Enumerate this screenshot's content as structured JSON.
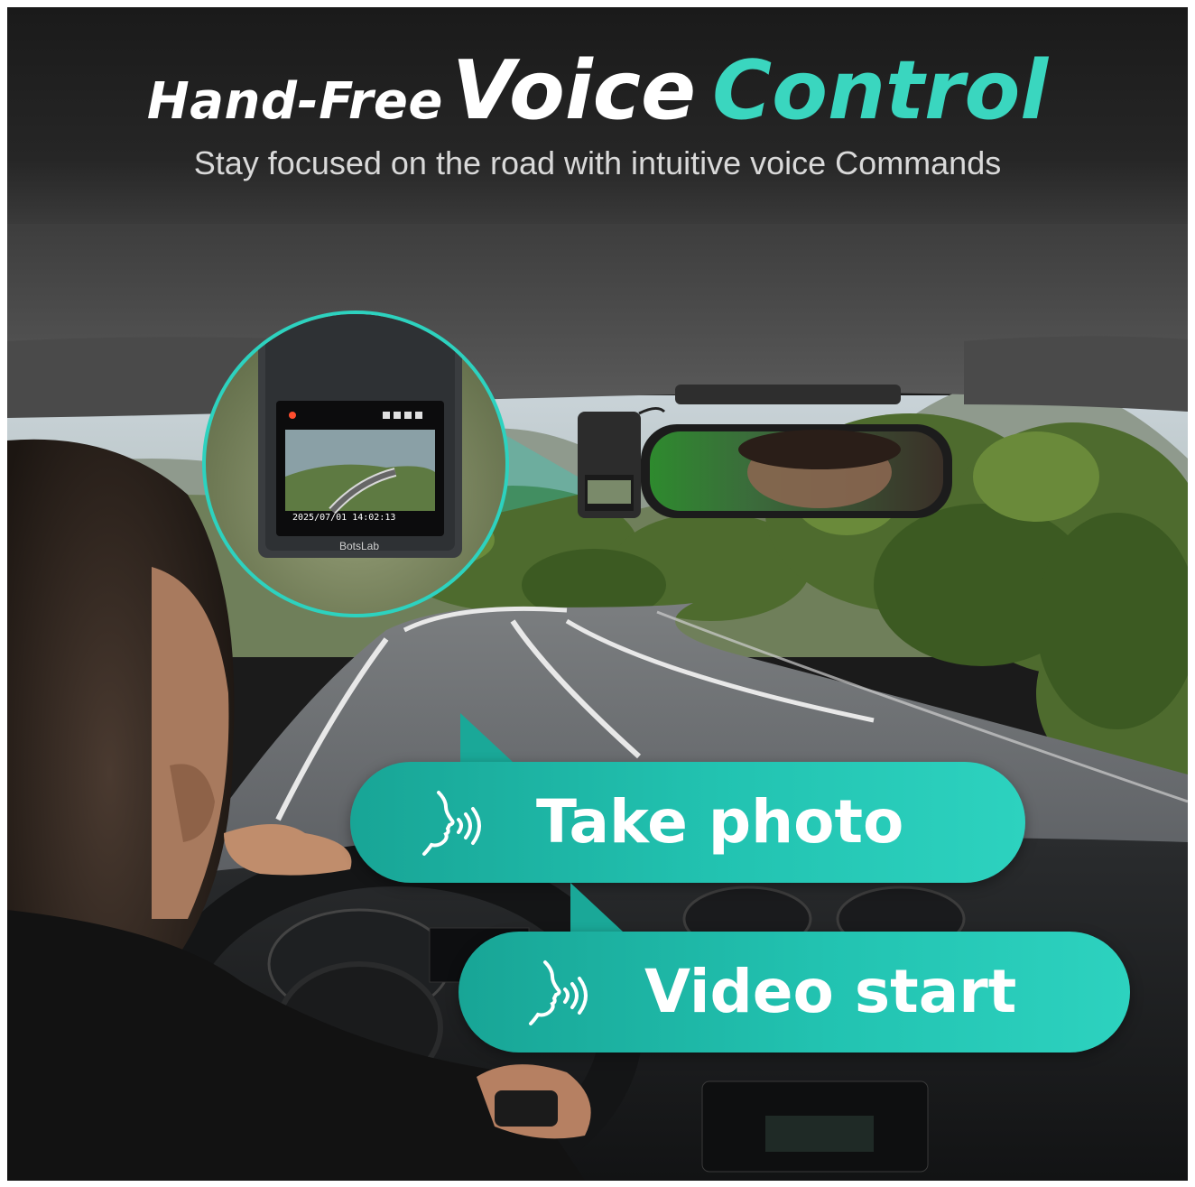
{
  "header": {
    "title_lead": "Hand-Free",
    "title_main": "Voice",
    "title_accent": "Control",
    "subtitle": "Stay focused on the road with intuitive voice Commands"
  },
  "bubbles": [
    {
      "label": "Take photo",
      "icon": "voice-speaking-icon"
    },
    {
      "label": "Video start",
      "icon": "voice-speaking-icon"
    }
  ],
  "dashcam": {
    "screen_datetime": "2025/07/01   14:02:13",
    "brand": "BotsLab"
  },
  "colors": {
    "accent": "#2dd2bf",
    "bubble_dark": "#18a596",
    "header_bg": "#1a1a1a"
  }
}
